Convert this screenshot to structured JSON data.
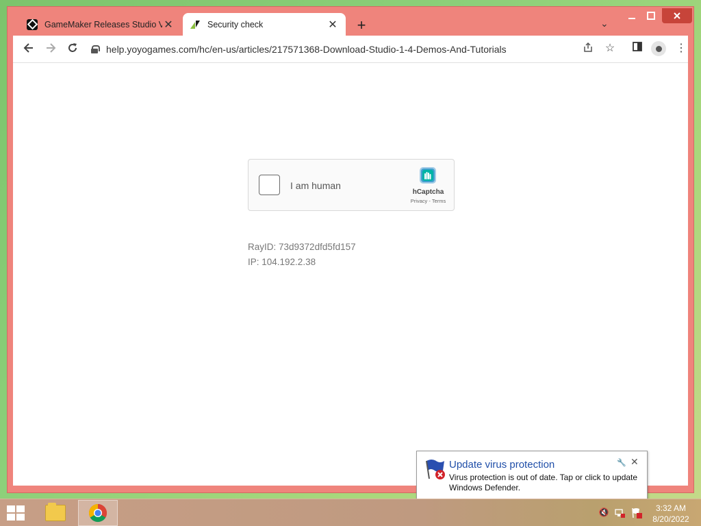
{
  "browser": {
    "tabs": [
      {
        "title": "GameMaker Releases Studio Vers",
        "active": false
      },
      {
        "title": "Security check",
        "active": true
      }
    ],
    "url": "help.yoyogames.com/hc/en-us/articles/217571368-Download-Studio-1-4-Demos-And-Tutorials"
  },
  "captcha": {
    "label": "I am human",
    "brand": "hCaptcha",
    "links": "Privacy - Terms"
  },
  "info": {
    "ray_id": "RayID: 73d9372dfd5fd157",
    "ip": "IP: 104.192.2.38"
  },
  "notification": {
    "title": "Update virus protection",
    "body": "Virus protection is out of date. Tap or click to update Windows Defender."
  },
  "taskbar": {
    "time": "3:32 AM",
    "date": "8/20/2022"
  },
  "colors": {
    "window_frame": "#ef847c",
    "notification_title": "#1f4ea8"
  }
}
